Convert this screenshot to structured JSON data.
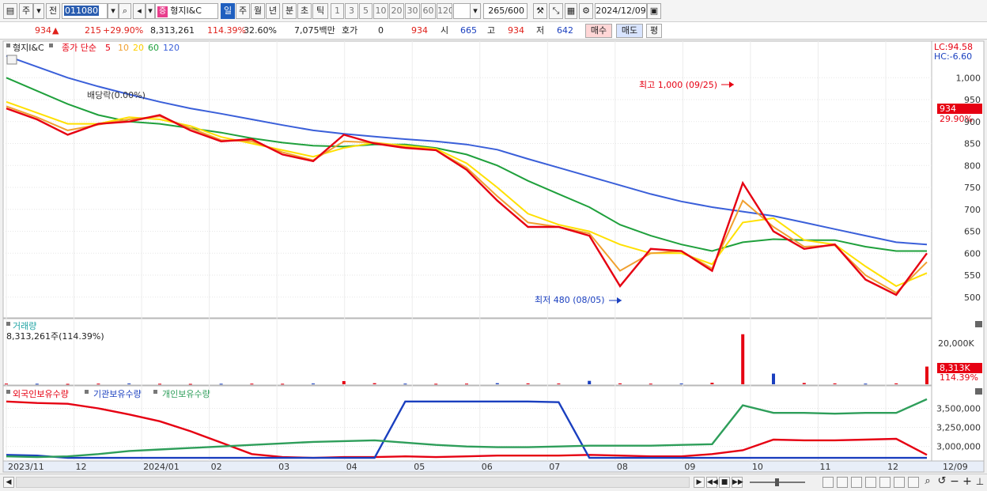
{
  "toolbar": {
    "period_label": "주",
    "prev_label": "전",
    "stock_code": "011080",
    "stock_tag": "증",
    "stock_name": "형지I&C",
    "periods": [
      "일",
      "주",
      "월",
      "년",
      "분",
      "초",
      "틱"
    ],
    "active_period": "일",
    "intervals": [
      "1",
      "3",
      "5",
      "10",
      "20",
      "30",
      "60",
      "120"
    ],
    "count_display": "265",
    "count_total": "/600",
    "date": "2024/12/09"
  },
  "quote": {
    "price": "934",
    "change": "215",
    "change_pct": "+29.90%",
    "volume": "8,313,261",
    "volume_ratio": "114.39%",
    "turnover": "32.60%",
    "amount": "7,075백만",
    "hoga_label": "호가",
    "hoga_value": "0",
    "hoga_price": "934",
    "open_label": "시",
    "open": "665",
    "high_label": "고",
    "high": "934",
    "low_label": "저",
    "low": "642",
    "buy_label": "매수",
    "sell_label": "매도",
    "eval_label": "평"
  },
  "price_panel": {
    "title": "형지I&C",
    "legend_prefix": "종가 단순",
    "ma_periods": [
      "5",
      "10",
      "20",
      "60",
      "120"
    ],
    "lc_label": "LC:94.58",
    "hc_label": "HC:-6.60",
    "current_price": "934",
    "current_pct": "29.90%",
    "high_annotation": "최고 1,000 (09/25)",
    "low_annotation": "최저 480 (08/05)",
    "dividend_annotation": "배당락(0.00%)"
  },
  "volume_panel": {
    "title": "거래량",
    "value_text": "8,313,261주(114.39%)",
    "axis_label": "20,000K",
    "current_value": "8,313K",
    "current_pct": "114.39%"
  },
  "holdings_panel": {
    "series_labels": [
      "외국인보유수량",
      "기관보유수량",
      "개인보유수량"
    ],
    "axis_labels": [
      "3,500,000",
      "3,250,000",
      "3,000,000"
    ]
  },
  "date_axis": [
    "2023/11",
    "12",
    "2024/01",
    "02",
    "03",
    "04",
    "05",
    "06",
    "07",
    "08",
    "09",
    "10",
    "11",
    "12",
    "12/09"
  ],
  "colors": {
    "ma5": "#e60012",
    "ma10": "#f0a030",
    "ma20": "#ffe000",
    "ma60": "#1fa03c",
    "ma120": "#3a5fd9",
    "up": "#e60012",
    "down": "#1a3fbf",
    "foreign": "#e60012",
    "institution": "#1a3fbf",
    "individual": "#2e9e5a"
  },
  "chart_data": [
    {
      "type": "line",
      "title": "형지I&C",
      "ylim": [
        460,
        1060
      ],
      "y_ticks": [
        500,
        550,
        600,
        650,
        700,
        750,
        800,
        850,
        900,
        950,
        1000
      ],
      "x_dates": [
        "2023/11",
        "12",
        "2024/01",
        "02",
        "03",
        "04",
        "05",
        "06",
        "07",
        "08",
        "09",
        "10",
        "11",
        "12",
        "12/09"
      ],
      "series": [
        {
          "name": "5",
          "values": [
            930,
            905,
            870,
            895,
            900,
            915,
            880,
            855,
            860,
            825,
            810,
            870,
            850,
            840,
            835,
            790,
            720,
            660,
            660,
            640,
            525,
            610,
            605,
            560,
            760,
            650,
            610,
            620,
            540,
            505,
            600
          ]
        },
        {
          "name": "10",
          "values": [
            935,
            910,
            880,
            893,
            905,
            912,
            885,
            858,
            855,
            830,
            812,
            855,
            852,
            842,
            835,
            795,
            730,
            670,
            660,
            645,
            560,
            600,
            605,
            565,
            720,
            660,
            615,
            618,
            550,
            510,
            580
          ]
        },
        {
          "name": "20",
          "values": [
            945,
            920,
            895,
            895,
            910,
            905,
            890,
            865,
            850,
            835,
            820,
            840,
            852,
            845,
            838,
            805,
            750,
            690,
            665,
            650,
            620,
            600,
            600,
            575,
            670,
            680,
            630,
            620,
            570,
            525,
            555
          ]
        },
        {
          "name": "60",
          "values": [
            1000,
            970,
            940,
            915,
            900,
            895,
            885,
            875,
            862,
            852,
            845,
            843,
            848,
            848,
            840,
            825,
            800,
            765,
            735,
            705,
            665,
            640,
            620,
            605,
            625,
            632,
            630,
            630,
            615,
            605,
            605
          ]
        },
        {
          "name": "120",
          "values": [
            1050,
            1025,
            1000,
            980,
            962,
            945,
            930,
            918,
            905,
            892,
            880,
            872,
            866,
            860,
            855,
            848,
            836,
            815,
            795,
            775,
            755,
            735,
            718,
            705,
            695,
            685,
            670,
            655,
            640,
            625,
            620
          ]
        }
      ],
      "labels": [
        "최고 1,000 (09/25)",
        "최저 480 (08/05)",
        "배당락(0.00%)"
      ]
    },
    {
      "type": "bar",
      "title": "거래량",
      "ylim": [
        0,
        26000
      ],
      "y_ticks": [
        20000
      ],
      "values_k": [
        300,
        250,
        200,
        300,
        350,
        250,
        200,
        250,
        300,
        250,
        350,
        1500,
        500,
        300,
        250,
        300,
        500,
        400,
        350,
        1600,
        400,
        300,
        350,
        700,
        23500,
        5000,
        600,
        400,
        300,
        400,
        8313
      ]
    },
    {
      "type": "line",
      "title": "보유수량",
      "ylim": [
        2820000,
        3650000
      ],
      "y_ticks": [
        3000000,
        3250000,
        3500000
      ],
      "series": [
        {
          "name": "외국인보유수량",
          "values": [
            3590000,
            3570000,
            3560000,
            3500000,
            3420000,
            3330000,
            3200000,
            3050000,
            2900000,
            2860000,
            2850000,
            2860000,
            2860000,
            2870000,
            2860000,
            2870000,
            2880000,
            2880000,
            2880000,
            2890000,
            2880000,
            2870000,
            2870000,
            2900000,
            2950000,
            3090000,
            3080000,
            3080000,
            3090000,
            3100000,
            2890000
          ]
        },
        {
          "name": "기관보유수량",
          "values": [
            2890000,
            2880000,
            2850000,
            2850000,
            2850000,
            2850000,
            2850000,
            2850000,
            2850000,
            2850000,
            2850000,
            2850000,
            2850000,
            3590000,
            3590000,
            3590000,
            3590000,
            3590000,
            3580000,
            2850000,
            2850000,
            2850000,
            2850000,
            2850000,
            2850000,
            2850000,
            2850000,
            2850000,
            2850000,
            2850000,
            2850000
          ]
        },
        {
          "name": "개인보유수량",
          "values": [
            2870000,
            2860000,
            2870000,
            2900000,
            2940000,
            2960000,
            2980000,
            3000000,
            3020000,
            3040000,
            3060000,
            3070000,
            3080000,
            3050000,
            3020000,
            3000000,
            2990000,
            2990000,
            3000000,
            3010000,
            3010000,
            3010000,
            3020000,
            3030000,
            3540000,
            3440000,
            3440000,
            3430000,
            3440000,
            3440000,
            3620000
          ]
        }
      ]
    }
  ]
}
